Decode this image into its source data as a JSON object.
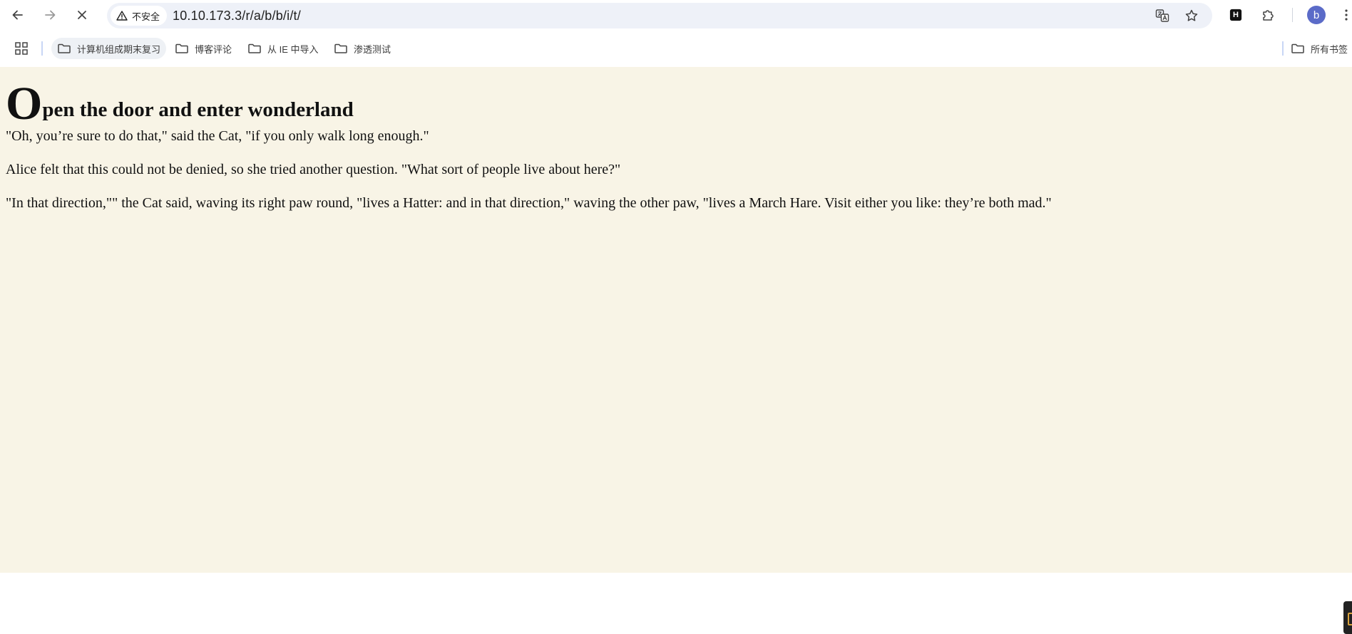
{
  "browser": {
    "url": "10.10.173.3/r/a/b/b/i/t/",
    "security_label": "不安全",
    "profile_initial": "b",
    "extension_badge": "H"
  },
  "bookmarks": {
    "items": [
      {
        "label": "计算机组成期末复习"
      },
      {
        "label": "博客评论"
      },
      {
        "label": "从 IE 中导入"
      },
      {
        "label": "渗透测试"
      }
    ],
    "all_bookmarks_label": "所有书签"
  },
  "page": {
    "heading_dropcap": "O",
    "heading_rest": "pen the door and enter wonderland",
    "paragraphs": [
      "\"Oh, you’re sure to do that,\" said the Cat, \"if you only walk long enough.\"",
      "Alice felt that this could not be denied, so she tried another question. \"What sort of people live about here?\"",
      "\"In that direction,\"\" the Cat said, waving its right paw round, \"lives a Hatter: and in that direction,\" waving the other paw, \"lives a March Hare. Visit either you like: they’re both mad.\""
    ]
  },
  "colors": {
    "page_background": "#f8f4e6",
    "omnibox_background": "#eef1f8",
    "avatar": "#5b6bc8"
  }
}
